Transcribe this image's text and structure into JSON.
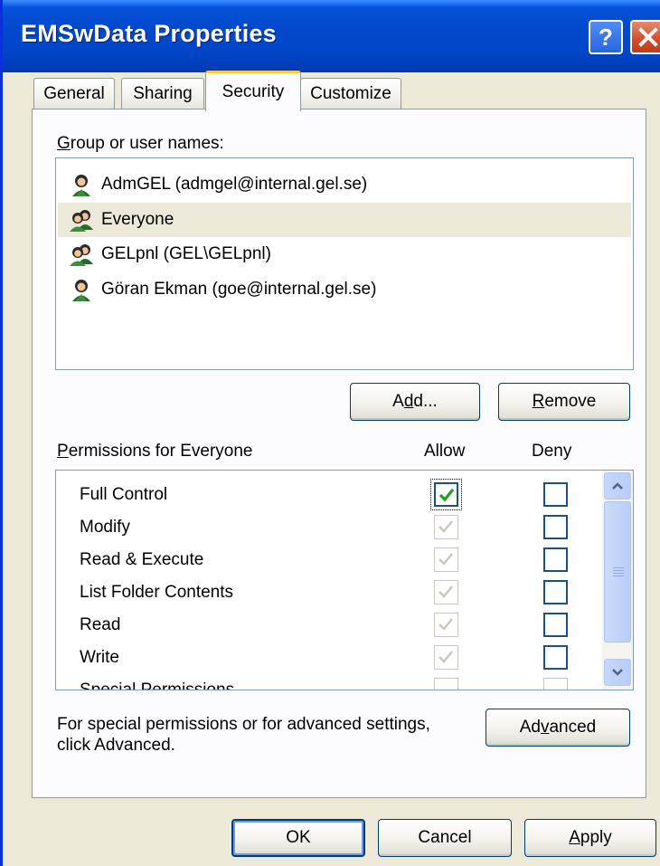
{
  "window": {
    "title": "EMSwData Properties",
    "help_label": "?"
  },
  "tabs": [
    {
      "label": "General"
    },
    {
      "label": "Sharing"
    },
    {
      "label": "Security",
      "active": true
    },
    {
      "label": "Customize"
    }
  ],
  "group_section": {
    "label_first": "G",
    "label_rest": "roup or user names:",
    "items": [
      {
        "label": "AdmGEL (admgel@internal.gel.se)",
        "icon": "user-icon",
        "selected": false
      },
      {
        "label": "Everyone",
        "icon": "group-icon",
        "selected": true
      },
      {
        "label": "GELpnl (GEL\\GELpnl)",
        "icon": "group-icon",
        "selected": false
      },
      {
        "label": "Göran Ekman (goe@internal.gel.se)",
        "icon": "user-icon",
        "selected": false
      }
    ],
    "add_button": {
      "pre": "A",
      "mnemonic": "d",
      "post": "d..."
    },
    "remove_button": {
      "mnemonic": "R",
      "post": "emove"
    }
  },
  "permissions": {
    "label_mnemonic": "P",
    "label_rest": "ermissions for Everyone",
    "allow_header": "Allow",
    "deny_header": "Deny",
    "rows": [
      {
        "name": "Full Control",
        "allow": true,
        "allow_enabled": true,
        "deny": false
      },
      {
        "name": "Modify",
        "allow": true,
        "allow_enabled": false,
        "deny": false
      },
      {
        "name": "Read & Execute",
        "allow": true,
        "allow_enabled": false,
        "deny": false
      },
      {
        "name": "List Folder Contents",
        "allow": true,
        "allow_enabled": false,
        "deny": false
      },
      {
        "name": "Read",
        "allow": true,
        "allow_enabled": false,
        "deny": false
      },
      {
        "name": "Write",
        "allow": true,
        "allow_enabled": false,
        "deny": false
      },
      {
        "name": "Special Permissions",
        "allow": false,
        "allow_enabled": false,
        "deny": false
      }
    ]
  },
  "advanced": {
    "text_line1": "For special permissions or for advanced settings,",
    "text_line2": "click Advanced.",
    "button_pre": "Ad",
    "button_mnemonic": "v",
    "button_post": "anced"
  },
  "footer": {
    "ok": "OK",
    "cancel": "Cancel",
    "apply_mnemonic": "A",
    "apply_rest": "pply"
  },
  "colors": {
    "titlebar": "#0046c8",
    "face": "#ece9d8",
    "check_green": "#21a121"
  }
}
